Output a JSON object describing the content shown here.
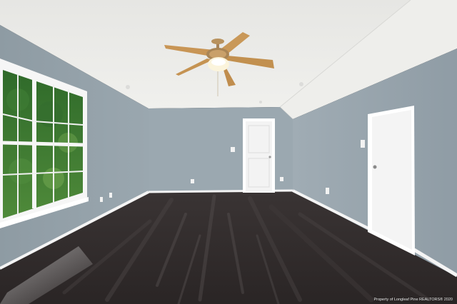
{
  "photo": {
    "subject": "Empty room with ceiling fan, window, and two doors",
    "watermark": "Property of Longleaf Pine REALTORS® 2020"
  },
  "colors": {
    "ceiling": "#ebebe9",
    "ceiling_slope": "#f1f1ee",
    "wall": "#98a5ad",
    "wall_left": "#8f9ca4",
    "wall_right": "#95a2ab",
    "trim": "#ffffff",
    "floor": "#2d2828",
    "floor_light": "#4d4747",
    "fan_blade": "#c89555",
    "fan_metal": "#b8925e"
  }
}
